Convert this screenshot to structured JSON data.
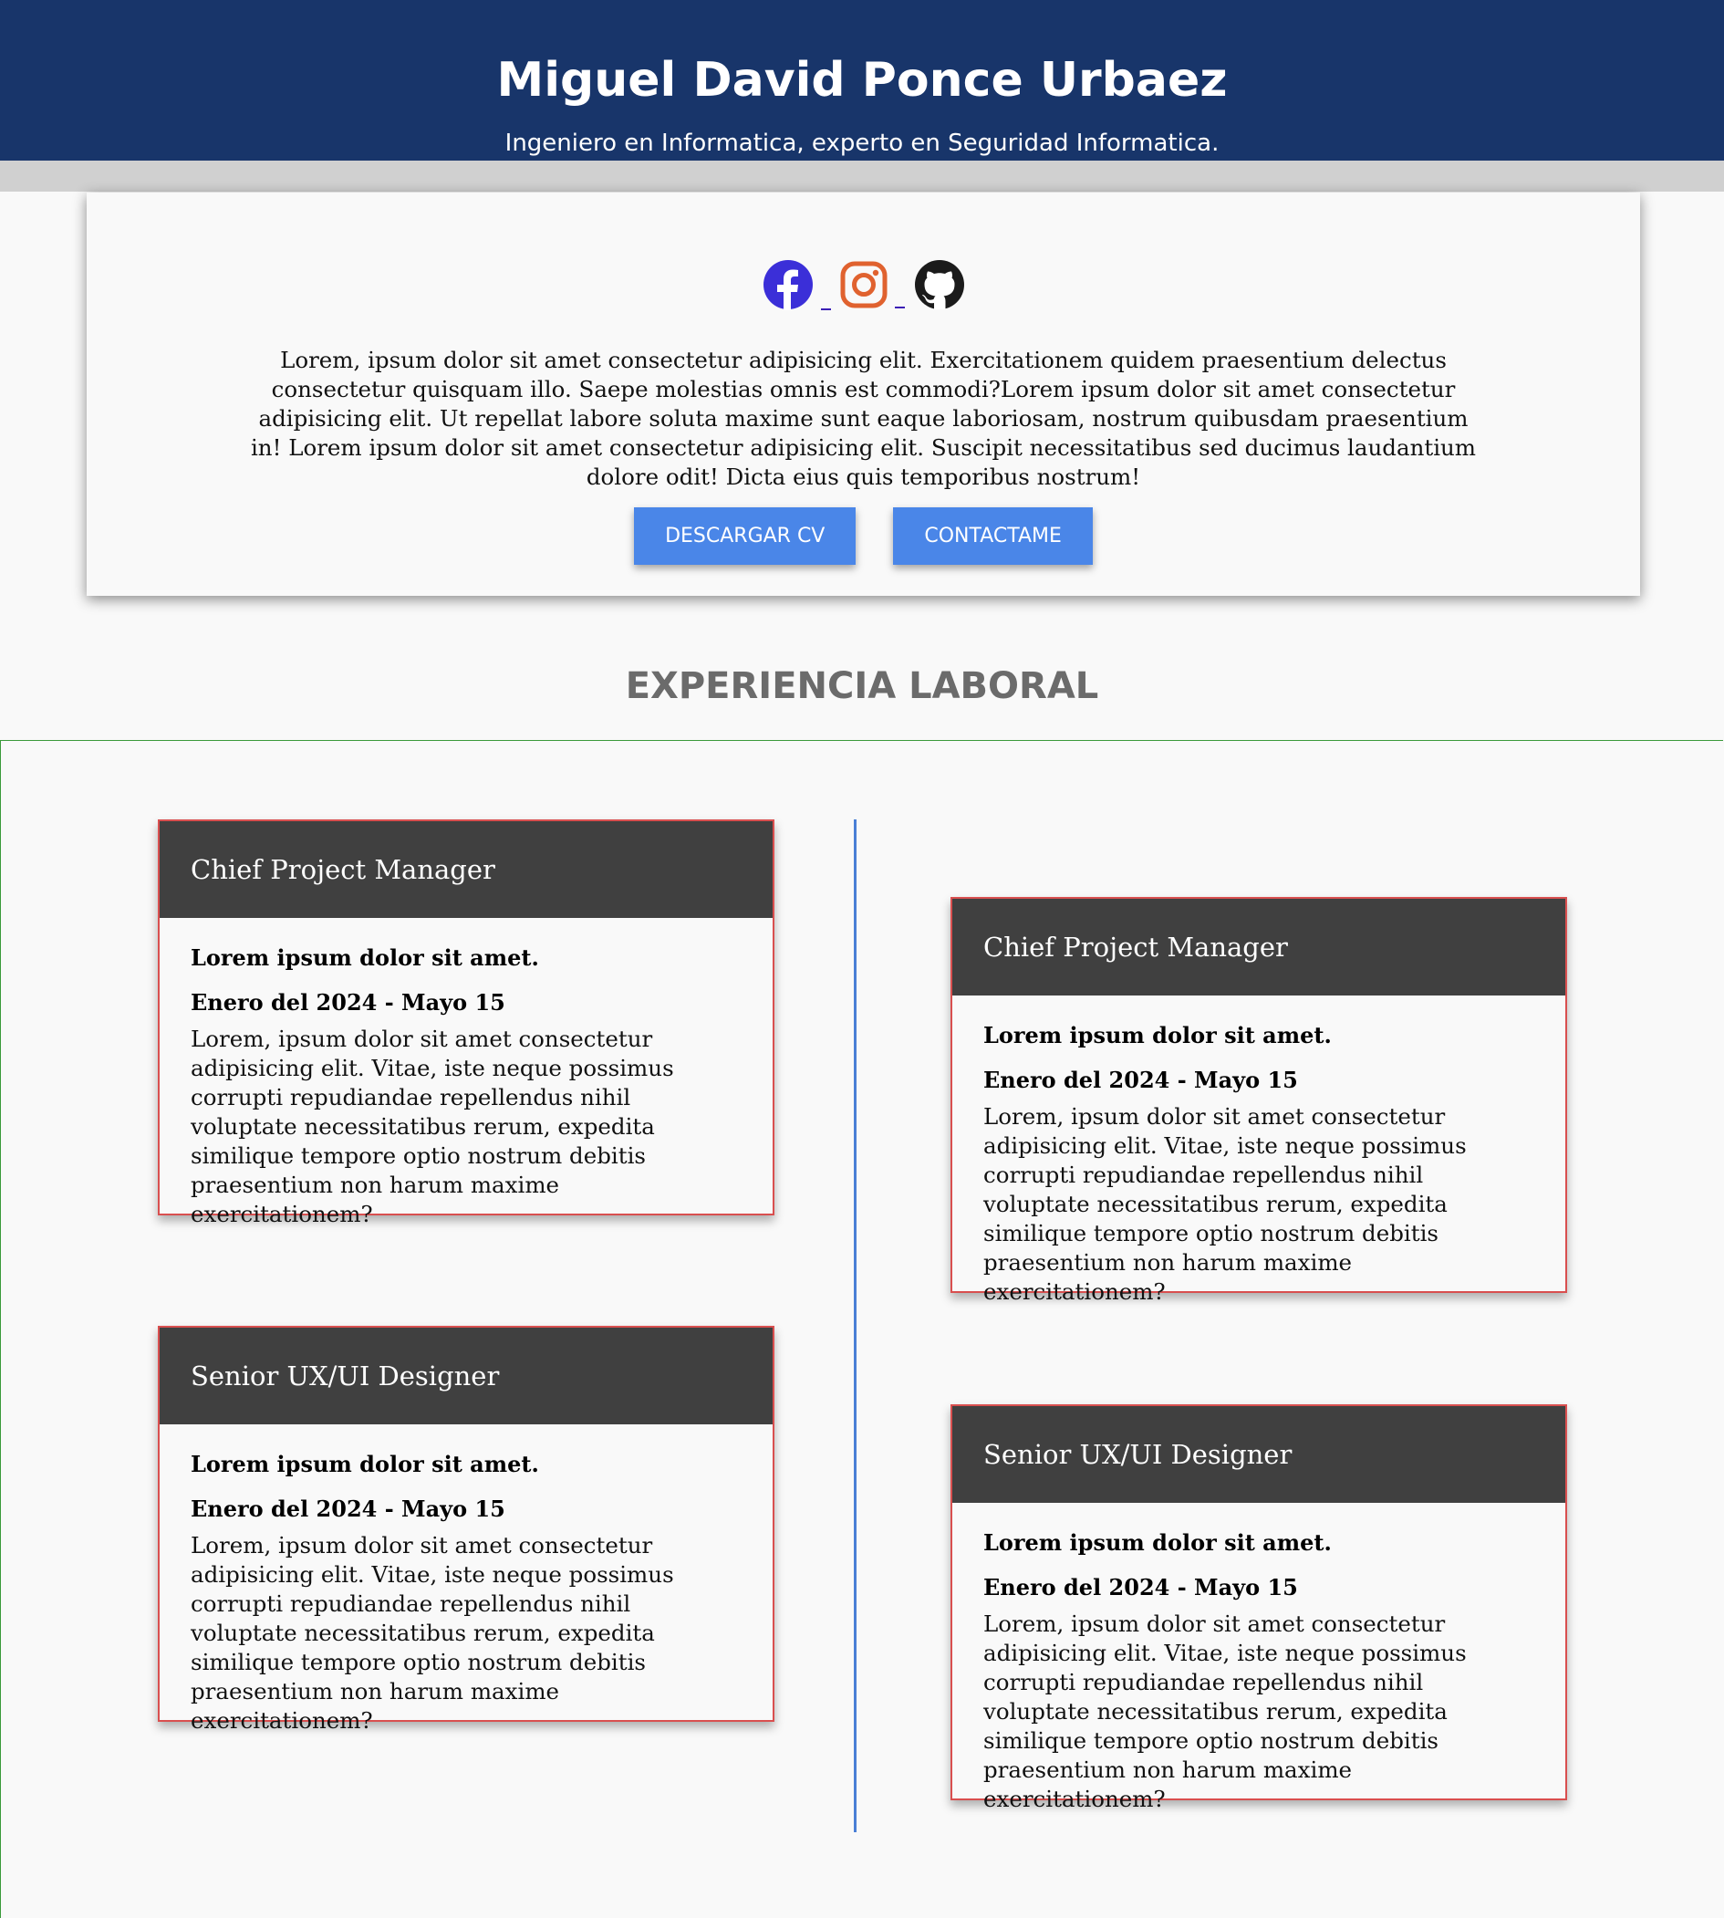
{
  "header": {
    "name": "Miguel David Ponce Urbaez",
    "subtitle": "Ingeniero en Informatica, experto en Seguridad Informatica."
  },
  "profile": {
    "socials": [
      {
        "name": "facebook-icon",
        "color": "#3b2fd8"
      },
      {
        "name": "instagram-icon",
        "color": "#e0622f"
      },
      {
        "name": "github-icon",
        "color": "#1b1b1b"
      }
    ],
    "about": "Lorem, ipsum dolor sit amet consectetur adipisicing elit. Exercitationem quidem praesentium delectus consectetur quisquam illo. Saepe molestias omnis est commodi?Lorem ipsum dolor sit amet consectetur adipisicing elit. Ut repellat labore soluta maxime sunt eaque laboriosam, nostrum quibusdam praesentium in! Lorem ipsum dolor sit amet consectetur adipisicing elit. Suscipit necessitatibus sed ducimus laudantium dolore odit! Dicta eius quis temporibus nostrum!",
    "download_label": "DESCARGAR CV",
    "contact_label": "CONTACTAME"
  },
  "experience": {
    "title": "EXPERIENCIA LABORAL",
    "jobs": [
      {
        "role": "Chief Project Manager",
        "company": "Lorem ipsum dolor sit amet.",
        "period": "Enero del 2024 - Mayo 15",
        "description": "Lorem, ipsum dolor sit amet consectetur adipisicing elit. Vitae, iste neque possimus corrupti repudiandae repellendus nihil voluptate necessitatibus rerum, expedita similique tempore optio nostrum debitis praesentium non harum maxime exercitationem?"
      },
      {
        "role": "Chief Project Manager",
        "company": "Lorem ipsum dolor sit amet.",
        "period": "Enero del 2024 - Mayo 15",
        "description": "Lorem, ipsum dolor sit amet consectetur adipisicing elit. Vitae, iste neque possimus corrupti repudiandae repellendus nihil voluptate necessitatibus rerum, expedita similique tempore optio nostrum debitis praesentium non harum maxime exercitationem?"
      },
      {
        "role": "Senior UX/UI Designer",
        "company": "Lorem ipsum dolor sit amet.",
        "period": "Enero del 2024 - Mayo 15",
        "description": "Lorem, ipsum dolor sit amet consectetur adipisicing elit. Vitae, iste neque possimus corrupti repudiandae repellendus nihil voluptate necessitatibus rerum, expedita similique tempore optio nostrum debitis praesentium non harum maxime exercitationem?"
      },
      {
        "role": "Senior UX/UI Designer",
        "company": "Lorem ipsum dolor sit amet.",
        "period": "Enero del 2024 - Mayo 15",
        "description": "Lorem, ipsum dolor sit amet consectetur adipisicing elit. Vitae, iste neque possimus corrupti repudiandae repellendus nihil voluptate necessitatibus rerum, expedita similique tempore optio nostrum debitis praesentium non harum maxime exercitationem?"
      }
    ]
  },
  "colors": {
    "header_bg": "#18356a",
    "button_bg": "#4a86e8",
    "card_border": "#d94f4f",
    "timeline_line": "#4a7fd6"
  }
}
